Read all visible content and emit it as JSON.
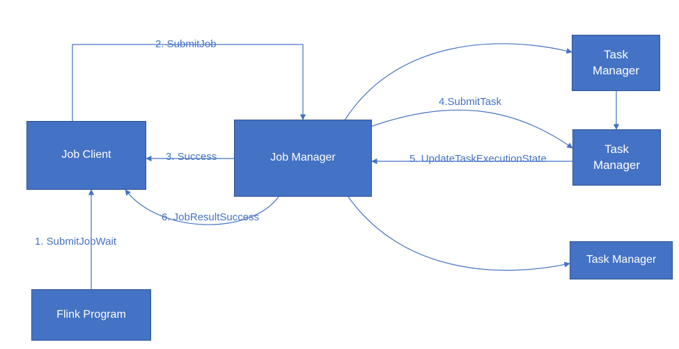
{
  "colors": {
    "box_fill": "#4472c4",
    "box_border": "#2f528f",
    "edge": "#4472c4",
    "label": "#4472c4"
  },
  "nodes": {
    "flink_program": "Flink Program",
    "job_client": "Job Client",
    "job_manager": "Job Manager",
    "task_manager_1": "Task\nManager",
    "task_manager_2": "Task\nManager",
    "task_manager_3": "Task Manager"
  },
  "edges": {
    "e1": "1. SubmitJobWait",
    "e2": "2. SubmitJob",
    "e3": "3. Success",
    "e4": "4.SubmitTask",
    "e5": "5. UpdateTaskExecutionState",
    "e6": "6. JobResultSuccess"
  },
  "chart_data": {
    "type": "diagram",
    "title": "",
    "nodes": [
      {
        "id": "flink_program",
        "label": "Flink Program"
      },
      {
        "id": "job_client",
        "label": "Job Client"
      },
      {
        "id": "job_manager",
        "label": "Job Manager"
      },
      {
        "id": "task_manager_1",
        "label": "Task Manager"
      },
      {
        "id": "task_manager_2",
        "label": "Task Manager"
      },
      {
        "id": "task_manager_3",
        "label": "Task Manager"
      }
    ],
    "edges": [
      {
        "from": "flink_program",
        "to": "job_client",
        "label": "1. SubmitJobWait"
      },
      {
        "from": "job_client",
        "to": "job_manager",
        "label": "2. SubmitJob"
      },
      {
        "from": "job_manager",
        "to": "job_client",
        "label": "3. Success"
      },
      {
        "from": "job_manager",
        "to": "task_manager_2",
        "label": "4.SubmitTask"
      },
      {
        "from": "task_manager_2",
        "to": "job_manager",
        "label": "5. UpdateTaskExecutionState"
      },
      {
        "from": "job_manager",
        "to": "job_client",
        "label": "6. JobResultSuccess"
      },
      {
        "from": "job_manager",
        "to": "task_manager_1",
        "label": ""
      },
      {
        "from": "task_manager_1",
        "to": "task_manager_2",
        "label": ""
      },
      {
        "from": "job_manager",
        "to": "task_manager_3",
        "label": ""
      }
    ]
  }
}
